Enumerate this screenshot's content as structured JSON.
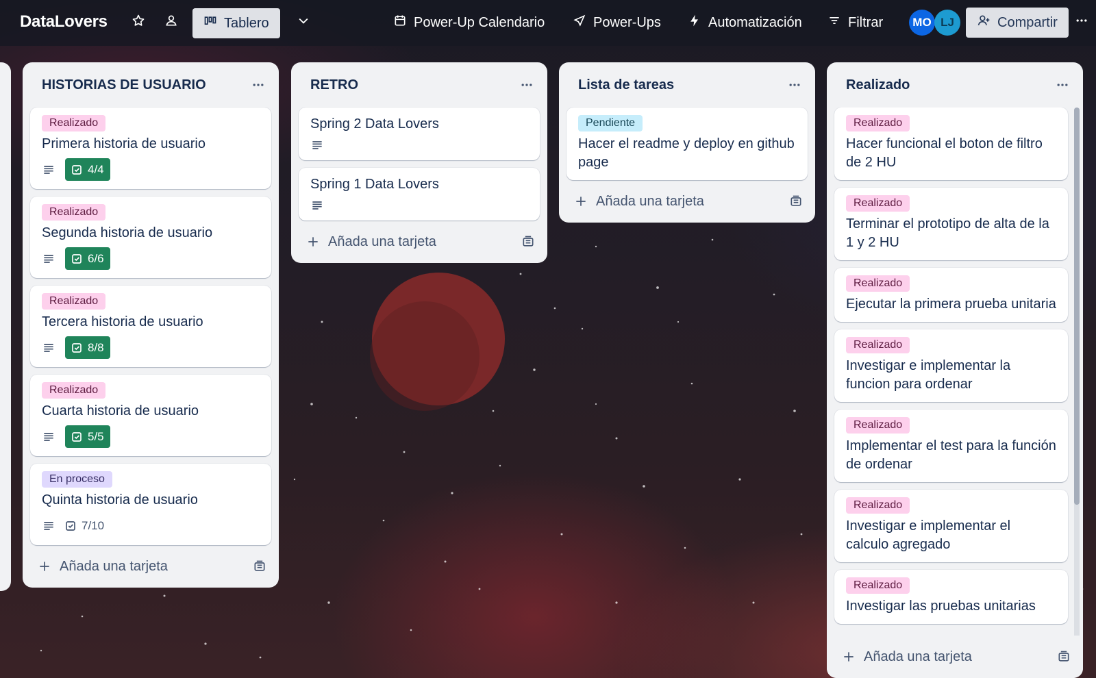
{
  "header": {
    "board_title": "DataLovers",
    "view_label": "Tablero",
    "calendar_label": "Power-Up Calendario",
    "powerups_label": "Power-Ups",
    "automation_label": "Automatización",
    "filter_label": "Filtrar",
    "share_label": "Compartir",
    "avatars": [
      {
        "initials": "MO",
        "color": "#0c66e4"
      },
      {
        "initials": "LJ",
        "color": "#1d9bd1"
      }
    ]
  },
  "lists": [
    {
      "title": "HISTORIAS DE USUARIO",
      "add_label": "Añada una tarjeta",
      "cards": [
        {
          "label": "Realizado",
          "title": "Primera historia de usuario",
          "checklist": "4/4"
        },
        {
          "label": "Realizado",
          "title": "Segunda historia de usuario",
          "checklist": "6/6"
        },
        {
          "label": "Realizado",
          "title": "Tercera historia de usuario",
          "checklist": "8/8"
        },
        {
          "label": "Realizado",
          "title": "Cuarta historia de usuario",
          "checklist": "5/5"
        },
        {
          "label": "En proceso",
          "title": "Quinta historia de usuario",
          "checklist": "7/10"
        }
      ]
    },
    {
      "title": "RETRO",
      "add_label": "Añada una tarjeta",
      "cards": [
        {
          "title": "Spring 2 Data Lovers"
        },
        {
          "title": "Spring 1 Data Lovers"
        }
      ]
    },
    {
      "title": "Lista de tareas",
      "add_label": "Añada una tarjeta",
      "cards": [
        {
          "label": "Pendiente",
          "title": "Hacer el readme y deploy en github page"
        }
      ]
    },
    {
      "title": "Realizado",
      "add_label": "Añada una tarjeta",
      "cards": [
        {
          "label": "Realizado",
          "title": "Hacer funcional el boton de filtro de 2 HU"
        },
        {
          "label": "Realizado",
          "title": "Terminar el prototipo de alta de la 1 y 2 HU"
        },
        {
          "label": "Realizado",
          "title": "Ejecutar la primera prueba unitaria"
        },
        {
          "label": "Realizado",
          "title": "Investigar e implementar la funcion para ordenar"
        },
        {
          "label": "Realizado",
          "title": "Implementar el test para la función de ordenar"
        },
        {
          "label": "Realizado",
          "title": "Investigar e implementar el calculo agregado"
        },
        {
          "label": "Realizado",
          "title": "Investigar las pruebas unitarias"
        }
      ]
    }
  ],
  "icons": [
    "star-icon",
    "people-icon",
    "board-icon",
    "chevron-down-icon",
    "calendar-icon",
    "rocket-icon",
    "bolt-icon",
    "filter-icon",
    "add-user-icon",
    "more-icon",
    "description-icon",
    "checklist-icon",
    "plus-icon",
    "template-icon"
  ]
}
